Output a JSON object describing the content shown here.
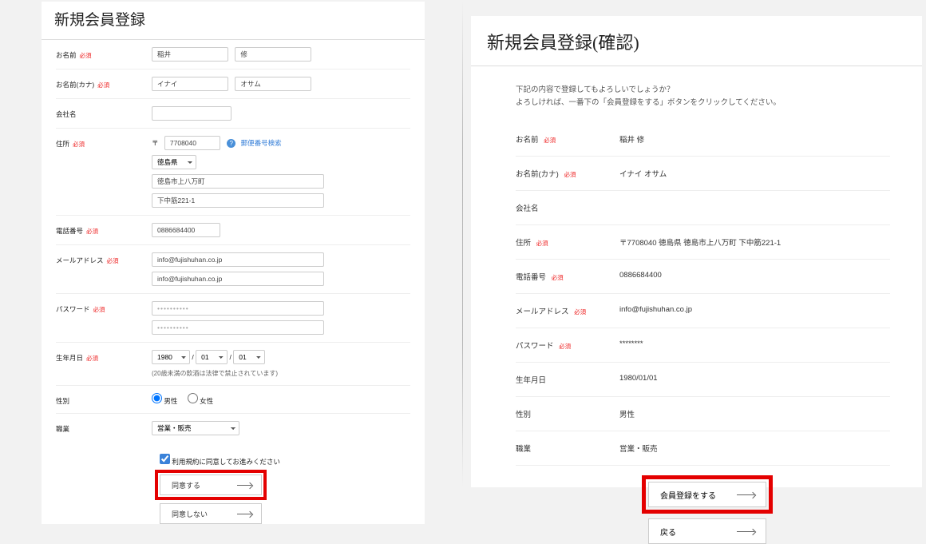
{
  "left": {
    "title": "新規会員登録",
    "labels": {
      "name": "お名前",
      "name_kana": "お名前(カナ)",
      "company": "会社名",
      "address": "住所",
      "phone": "電話番号",
      "email": "メールアドレス",
      "password": "パスワード",
      "birth": "生年月日",
      "gender": "性別",
      "job": "職業",
      "required": "必須"
    },
    "name_sei": "稲井",
    "name_mei": "修",
    "kana_sei": "イナイ",
    "kana_mei": "オサム",
    "company": "",
    "zip_prefix": "〒",
    "zip": "7708040",
    "zip_link": "郵便番号検索",
    "pref": "徳島県",
    "addr1": "徳島市上八万町",
    "addr2": "下中筋221-1",
    "phone": "0886684400",
    "email1": "info@fujishuhan.co.jp",
    "email2": "info@fujishuhan.co.jp",
    "pw1": "••••••••••",
    "pw2": "••••••••••",
    "birth_year": "1980",
    "birth_month": "01",
    "birth_day": "01",
    "birth_note": "(20歳未満の飲酒は法律で禁止されています)",
    "gender_male": "男性",
    "gender_female": "女性",
    "job": "営業・販売",
    "agree_label": "利用規約に同意してお進みください",
    "btn_agree": "同意する",
    "btn_disagree": "同意しない"
  },
  "right": {
    "title": "新規会員登録(確認)",
    "note1": "下記の内容で登録してもよろしいでしょうか？",
    "note2": "よろしければ、一番下の「会員登録をする」ボタンをクリックしてください。",
    "labels": {
      "name": "お名前",
      "name_kana": "お名前(カナ)",
      "company": "会社名",
      "address": "住所",
      "phone": "電話番号",
      "email": "メールアドレス",
      "password": "パスワード",
      "birth": "生年月日",
      "gender": "性別",
      "job": "職業",
      "required": "必須"
    },
    "name": "稲井 修",
    "name_kana": "イナイ オサム",
    "company": "",
    "address": "〒7708040 徳島県 徳島市上八万町 下中筋221-1",
    "phone": "0886684400",
    "email": "info@fujishuhan.co.jp",
    "password": "********",
    "birth": "1980/01/01",
    "gender": "男性",
    "job": "営業・販売",
    "btn_register": "会員登録をする",
    "btn_back": "戻る"
  }
}
